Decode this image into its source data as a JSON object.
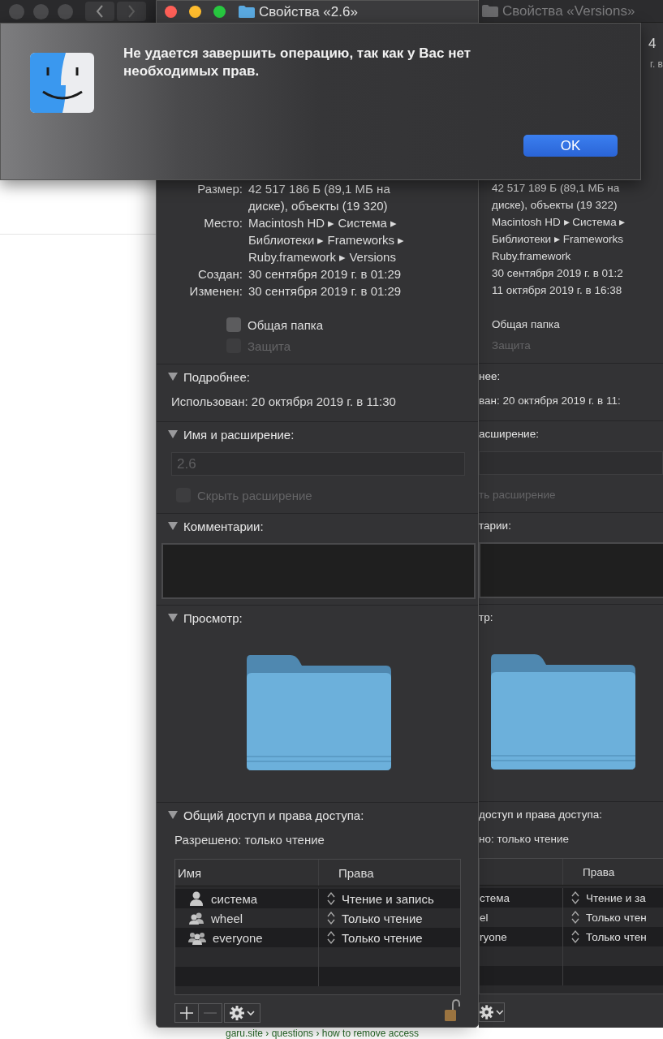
{
  "footer_link": "garu.site › questions › how to remove access",
  "windows": [
    {
      "kind": "front",
      "title": "Свойства «2.6»",
      "active": true,
      "info": [
        {
          "label": "Размер:",
          "lines": [
            "42 517 186 Б (89,1 МБ на",
            "диске), объекты (19 320)"
          ]
        },
        {
          "label": "Место:",
          "lines": [
            "Macintosh HD ▸ Система ▸",
            "Библиотеки ▸ Frameworks ▸",
            "Ruby.framework ▸ Versions"
          ]
        },
        {
          "label": "Создан:",
          "lines": [
            "30 сентября 2019 г. в 01:29"
          ]
        },
        {
          "label": "Изменен:",
          "lines": [
            "30 сентября 2019 г. в 01:29"
          ]
        }
      ],
      "checkboxes": [
        {
          "label": "Общая папка",
          "checked": false,
          "disabled": false
        },
        {
          "label": "Защита",
          "checked": false,
          "disabled": true
        }
      ],
      "more_info": {
        "heading": "Подробнее:",
        "expanded": true,
        "text": "Использован: 20 октября 2019 г. в 11:30"
      },
      "name_ext": {
        "heading": "Имя и расширение:",
        "expanded": true,
        "name": "2.6",
        "name_disabled": true,
        "hide_extension": {
          "label": "Скрыть расширение",
          "checked": false,
          "disabled": true
        }
      },
      "comments": {
        "heading": "Комментарии:",
        "expanded": true
      },
      "preview": {
        "heading": "Просмотр:",
        "expanded": true
      },
      "sharing": {
        "heading": "Общий доступ и права доступа:",
        "expanded": true,
        "summary": "Разрешено: только чтение",
        "name_column": "Имя",
        "rights_column": "Права",
        "rows": [
          {
            "kind": "user",
            "name": "система",
            "privilege": "Чтение и запись"
          },
          {
            "kind": "group",
            "name": "wheel",
            "privilege": "Только чтение"
          },
          {
            "kind": "everyone",
            "name": "everyone",
            "privilege": "Только чтение"
          }
        ]
      }
    },
    {
      "kind": "back",
      "title": "Свойства «Versions»",
      "active": false,
      "corner_texts": [
        "4",
        "г. в"
      ],
      "info": [
        {
          "lines": [
            "42 517 189 Б (89,1 МБ на",
            "диске), объекты (19 322)"
          ]
        },
        {
          "lines": [
            "Macintosh HD ▸ Система ▸",
            "Библиотеки ▸ Frameworks",
            "Ruby.framework"
          ]
        },
        {
          "lines": [
            "30 сентября 2019 г. в 01:2"
          ]
        },
        {
          "lines": [
            "11 октября 2019 г. в 16:38"
          ]
        }
      ],
      "checkboxes": [
        {
          "label": "Общая папка",
          "disabled": false
        },
        {
          "label": "Защита",
          "disabled": true
        }
      ],
      "more_info": {
        "heading": "нее:",
        "text": "ван: 20 октября 2019 г. в 11:"
      },
      "name_ext": {
        "heading": "асширение:",
        "hide_extension": {
          "label": "ть расширение",
          "disabled": true
        }
      },
      "comments": {
        "heading": "тарии:"
      },
      "preview": {
        "heading": "тр:"
      },
      "sharing": {
        "heading": "доступ и права доступа:",
        "summary": "но: только чтение",
        "rights_column": "Права",
        "rows": [
          {
            "name": "стема",
            "privilege": "Чтение и за"
          },
          {
            "name": "el",
            "privilege": "Только чтен"
          },
          {
            "name": "ryone",
            "privilege": "Только чтен"
          }
        ]
      }
    }
  ],
  "alert": {
    "message": "Не удается завершить операцию, так как у Вас нет необходимых прав.",
    "button": "OK"
  }
}
